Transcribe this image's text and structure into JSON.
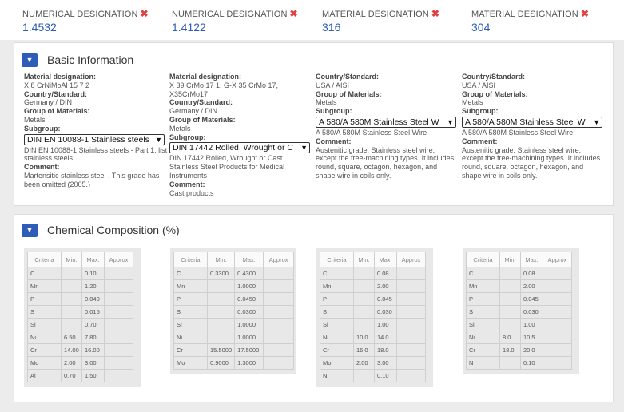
{
  "header": [
    {
      "label": "NUMERICAL DESIGNATION",
      "value": "1.4532"
    },
    {
      "label": "NUMERICAL DESIGNATION",
      "value": "1.4122"
    },
    {
      "label": "MATERIAL DESIGNATION",
      "value": "316"
    },
    {
      "label": "MATERIAL DESIGNATION",
      "value": "304"
    }
  ],
  "remove_icon": "✖",
  "basic": {
    "title": "Basic Information",
    "toggle_icon": "▼",
    "cols": [
      {
        "l1": "Material designation:",
        "v1": "X 8 CrNiMoAl 15 7 2",
        "l2": "Country/Standard:",
        "v2": "Germany / DIN",
        "l3": "Group of Materials:",
        "v3": "Metals",
        "l4": "Subgroup:",
        "select": "DIN EN 10088-1 Stainless steels",
        "sub_desc": "DIN EN 10088-1 Stainless steels - Part 1: list of stainless steels",
        "l5": "Comment:",
        "comment": "Martensitic stainless steel . This grade has been omitted (2005.)"
      },
      {
        "l1": "Material designation:",
        "v1": "X 39 CrMo 17 1, G-X 35 CrMo 17, X35CrMo17",
        "l2": "Country/Standard:",
        "v2": "Germany / DIN",
        "l3": "Group of Materials:",
        "v3": "Metals",
        "l4": "Subgroup:",
        "select": "DIN 17442 Rolled, Wrought or C",
        "sub_desc": "DIN 17442 Rolled, Wrought or Cast Stainless Steel Products for Medical Instruments",
        "l5": "Comment:",
        "comment": "Cast products"
      },
      {
        "l1": "Country/Standard:",
        "v1": "USA / AISI",
        "l2": "Group of Materials:",
        "v2": "Metals",
        "l3": "Subgroup:",
        "select": "A 580/A 580M Stainless Steel W",
        "sub_desc": "A 580/A 580M Stainless Steel Wire",
        "l4": "Comment:",
        "comment": "Austenitic grade. Stainless steel wire, except the free-machining types. It includes round, square, octagon, hexagon, and shape wire in coils only."
      },
      {
        "l1": "Country/Standard:",
        "v1": "USA / AISI",
        "l2": "Group of Materials:",
        "v2": "Metals",
        "l3": "Subgroup:",
        "select": "A 580/A 580M Stainless Steel W",
        "sub_desc": "A 580/A 580M Stainless Steel Wire",
        "l4": "Comment:",
        "comment": "Austenitic grade. Stainless steel wire, except the free-machining types. It includes round, square, octagon, hexagon, and shape wire in coils only."
      }
    ]
  },
  "chem": {
    "title": "Chemical Composition (%)",
    "toggle_icon": "▼",
    "headers": [
      "Criteria",
      "Min.",
      "Max.",
      "Approx"
    ],
    "tables": [
      [
        [
          "C",
          "",
          "0.10",
          ""
        ],
        [
          "Mn",
          "",
          "1.20",
          ""
        ],
        [
          "P",
          "",
          "0.040",
          ""
        ],
        [
          "S",
          "",
          "0.015",
          ""
        ],
        [
          "Si",
          "",
          "0.70",
          ""
        ],
        [
          "Ni",
          "6.50",
          "7.80",
          ""
        ],
        [
          "Cr",
          "14.00",
          "16.00",
          ""
        ],
        [
          "Mo",
          "2.00",
          "3.00",
          ""
        ],
        [
          "Al",
          "0.70",
          "1.50",
          ""
        ]
      ],
      [
        [
          "C",
          "0.3300",
          "0.4300",
          ""
        ],
        [
          "Mn",
          "",
          "1.0000",
          ""
        ],
        [
          "P",
          "",
          "0.0450",
          ""
        ],
        [
          "S",
          "",
          "0.0300",
          ""
        ],
        [
          "Si",
          "",
          "1.0000",
          ""
        ],
        [
          "Ni",
          "",
          "1.0000",
          ""
        ],
        [
          "Cr",
          "15.5000",
          "17.5000",
          ""
        ],
        [
          "Mo",
          "0.9000",
          "1.3000",
          ""
        ]
      ],
      [
        [
          "C",
          "",
          "0.08",
          ""
        ],
        [
          "Mn",
          "",
          "2.00",
          ""
        ],
        [
          "P",
          "",
          "0.045",
          ""
        ],
        [
          "S",
          "",
          "0.030",
          ""
        ],
        [
          "Si",
          "",
          "1.00",
          ""
        ],
        [
          "Ni",
          "10.0",
          "14.0",
          ""
        ],
        [
          "Cr",
          "16.0",
          "18.0",
          ""
        ],
        [
          "Mo",
          "2.00",
          "3.00",
          ""
        ],
        [
          "N",
          "",
          "0.10",
          ""
        ]
      ],
      [
        [
          "C",
          "",
          "0.08",
          ""
        ],
        [
          "Mn",
          "",
          "2.00",
          ""
        ],
        [
          "P",
          "",
          "0.045",
          ""
        ],
        [
          "S",
          "",
          "0.030",
          ""
        ],
        [
          "Si",
          "",
          "1.00",
          ""
        ],
        [
          "Ni",
          "8.0",
          "10.5",
          ""
        ],
        [
          "Cr",
          "18.0",
          "20.0",
          ""
        ],
        [
          "N",
          "",
          "0.10",
          ""
        ]
      ]
    ]
  }
}
